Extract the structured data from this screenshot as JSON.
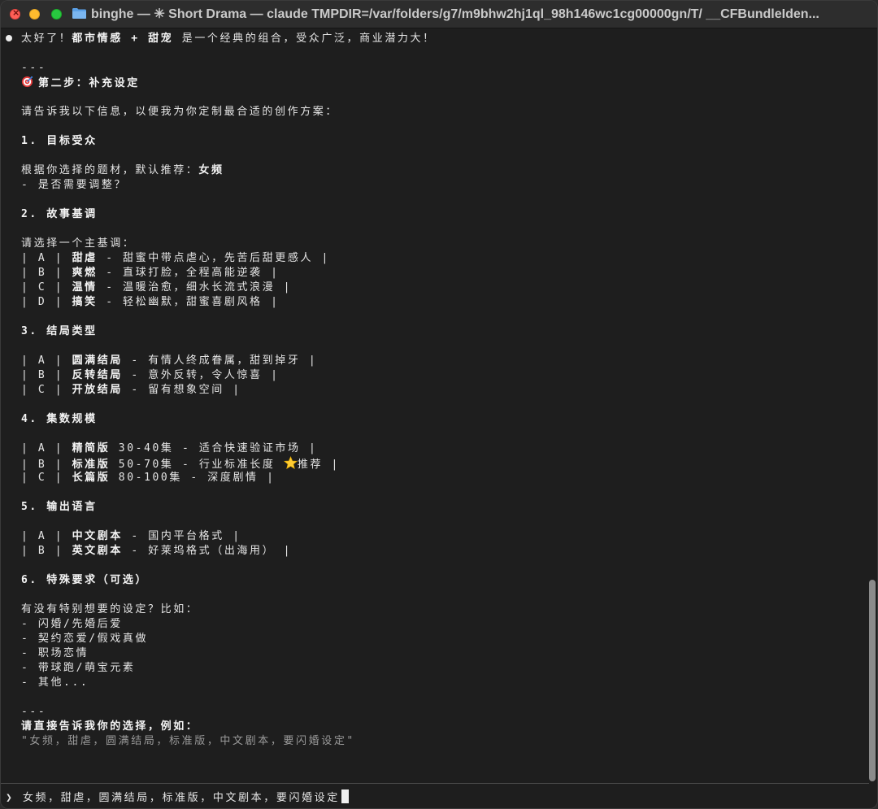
{
  "window": {
    "title": "binghe — ✳ Short Drama — claude TMPDIR=/var/folders/g7/m9bhw2hj1ql_98h146wc1cg00000gn/T/ __CFBundleIden..."
  },
  "response": {
    "intro_prefix": "太好了！",
    "intro_bold": "都市情感 + 甜宠",
    "intro_suffix": " 是一个经典的组合，受众广泛，商业潜力大！",
    "rule1": "---",
    "step_title": "第二步：补充设定",
    "request": "请告诉我以下信息，以便我为你定制最合适的创作方案：",
    "s1_title": "1. 目标受众",
    "s1_line1_prefix": "根据你选择的题材，默认推荐：",
    "s1_line1_bold": "女频",
    "s1_line2": "- 是否需要调整？",
    "s2_title": "2. 故事基调",
    "s2_intro": "请选择一个主基调：",
    "s2_rows": [
      {
        "pre": "| A | ",
        "bold": "甜虐",
        "post": " - 甜蜜中带点虐心，先苦后甜更感人 |"
      },
      {
        "pre": "| B | ",
        "bold": "爽燃",
        "post": " - 直球打脸，全程高能逆袭 |"
      },
      {
        "pre": "| C | ",
        "bold": "温情",
        "post": " - 温暖治愈，细水长流式浪漫 |"
      },
      {
        "pre": "| D | ",
        "bold": "搞笑",
        "post": " - 轻松幽默，甜蜜喜剧风格 |"
      }
    ],
    "s3_title": "3. 结局类型",
    "s3_rows": [
      {
        "pre": "| A | ",
        "bold": "圆满结局",
        "post": " - 有情人终成眷属，甜到掉牙 |"
      },
      {
        "pre": "| B | ",
        "bold": "反转结局",
        "post": " - 意外反转，令人惊喜 |"
      },
      {
        "pre": "| C | ",
        "bold": "开放结局",
        "post": " - 留有想象空间 |"
      }
    ],
    "s4_title": "4. 集数规模",
    "s4_rows": [
      {
        "pre": "| A | ",
        "bold": "精简版",
        "post": " 30-40集 - 适合快速验证市场 |"
      },
      {
        "pre": "| B | ",
        "bold": "标准版",
        "post": " 50-70集 - 行业标准长度 ",
        "star": true,
        "post2": "推荐 |"
      },
      {
        "pre": "| C | ",
        "bold": "长篇版",
        "post": " 80-100集 - 深度剧情 |"
      }
    ],
    "s5_title": "5. 输出语言",
    "s5_rows": [
      {
        "pre": "| A | ",
        "bold": "中文剧本",
        "post": " - 国内平台格式 |"
      },
      {
        "pre": "| B | ",
        "bold": "英文剧本",
        "post": " - 好莱坞格式（出海用） |"
      }
    ],
    "s6_title": "6. 特殊要求（可选）",
    "s6_intro": "有没有特别想要的设定？比如：",
    "s6_items": [
      "- 闪婚/先婚后爱",
      "- 契约恋爱/假戏真做",
      "- 职场恋情",
      "- 带球跑/萌宝元素",
      "- 其他..."
    ],
    "rule2": "---",
    "closing_bold": "请直接告诉我你的选择，例如：",
    "closing_example": "\"女频，甜虐，圆满结局，标准版，中文剧本，要闪婚设定\""
  },
  "prompt": {
    "symbol": "❯",
    "input_value": "女频，甜虐，圆满结局，标准版，中文剧本，要闪婚设定"
  },
  "icons": {
    "bullet": "bullet-dot-icon",
    "step": "target-icon",
    "recommend": "star-icon",
    "folder": "folder-icon"
  },
  "colors": {
    "terminal_bg": "#1e1e1e",
    "text": "#e6e6e6",
    "dim_text": "#9a9a9a",
    "close": "#fe5f57",
    "minimize": "#febc2e",
    "maximize": "#28c840"
  }
}
